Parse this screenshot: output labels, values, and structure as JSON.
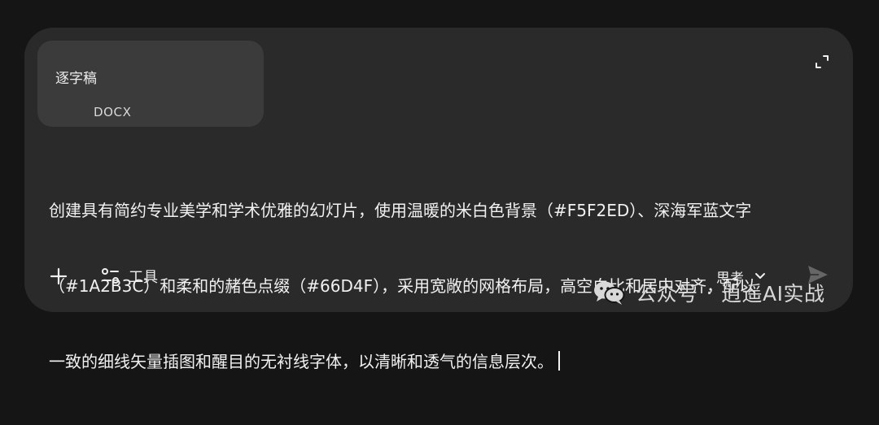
{
  "attachment": {
    "name": "逐字稿",
    "type": "DOCX"
  },
  "prompt": {
    "lines": [
      "创建具有简约专业美学和学术优雅的幻灯片，使用温暖的米白色背景（#F5F2ED）、深海军蓝文字",
      "（#1A2B3C）和柔和的赭色点缀（#66D4F），采用宽敞的网格布局，高空白比和居中对齐，配以",
      "一致的细线矢量插图和醒目的无衬线字体，以清晰和透气的信息层次。"
    ]
  },
  "toolbar": {
    "tools_label": "工具",
    "think_label": "思考"
  },
  "watermark": {
    "public_account": "公众号",
    "separator": "·",
    "name": "逍遥AI实战"
  },
  "icons": {
    "expand": "expand-icon",
    "plus": "plus-icon",
    "tools": "sliders-icon",
    "chevron": "chevron-down-icon",
    "send": "send-icon",
    "wechat": "wechat-icon"
  }
}
